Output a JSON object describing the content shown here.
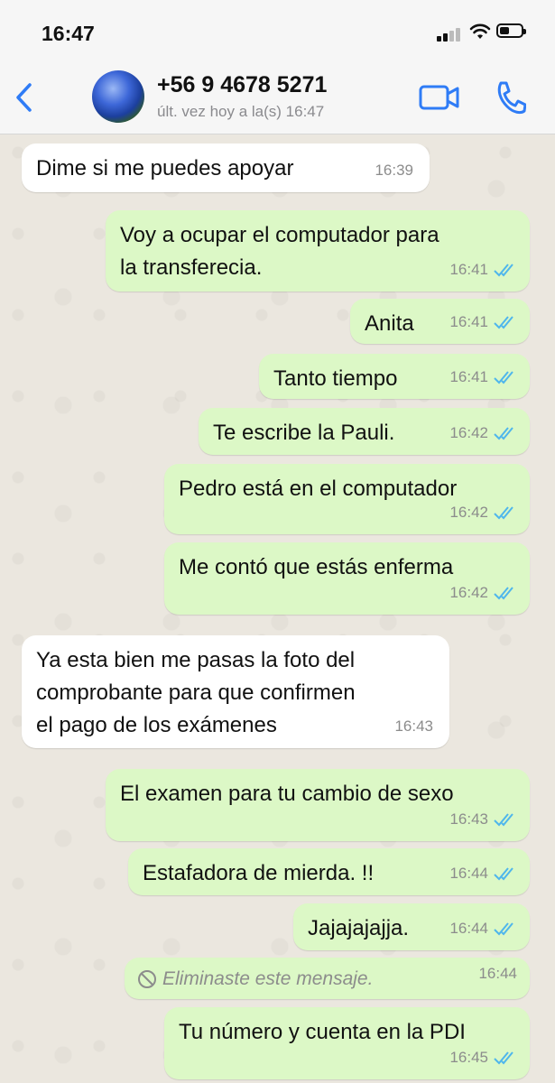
{
  "status_bar": {
    "time": "16:47"
  },
  "header": {
    "contact_name": "+56 9 4678 5271",
    "last_seen": "últ. vez hoy a la(s) 16:47"
  },
  "messages": [
    {
      "direction": "in",
      "text": "Dime si me puedes apoyar",
      "time": "16:39"
    },
    {
      "direction": "out",
      "text": "Voy a ocupar el computador para\nla transferecia.",
      "time": "16:41",
      "read": true
    },
    {
      "direction": "out",
      "text": "Anita",
      "time": "16:41",
      "read": true
    },
    {
      "direction": "out",
      "text": "Tanto tiempo",
      "time": "16:41",
      "read": true
    },
    {
      "direction": "out",
      "text": "Te escribe la Pauli.",
      "time": "16:42",
      "read": true
    },
    {
      "direction": "out",
      "text": "Pedro está en el computador",
      "time": "16:42",
      "read": true
    },
    {
      "direction": "out",
      "text": "Me contó que estás enferma",
      "time": "16:42",
      "read": true
    },
    {
      "direction": "in",
      "text": "Ya esta bien me pasas la foto del\ncomprobante para que confirmen\nel pago de los exámenes",
      "time": "16:43"
    },
    {
      "direction": "out",
      "text": "El examen para tu cambio de sexo",
      "time": "16:43",
      "read": true
    },
    {
      "direction": "out",
      "text": "Estafadora de mierda.  !!",
      "time": "16:44",
      "read": true
    },
    {
      "direction": "out",
      "text": "Jajajajajja.",
      "time": "16:44",
      "read": true
    },
    {
      "direction": "out",
      "text": "Eliminaste este mensaje.",
      "time": "16:44",
      "deleted": true
    },
    {
      "direction": "out",
      "text": "Tu número y cuenta en la PDI",
      "time": "16:45",
      "read": true
    }
  ],
  "colors": {
    "accent": "#2f7cf6",
    "outgoing_bubble": "#dcf8c6",
    "read_ticks": "#4fb6ec"
  }
}
